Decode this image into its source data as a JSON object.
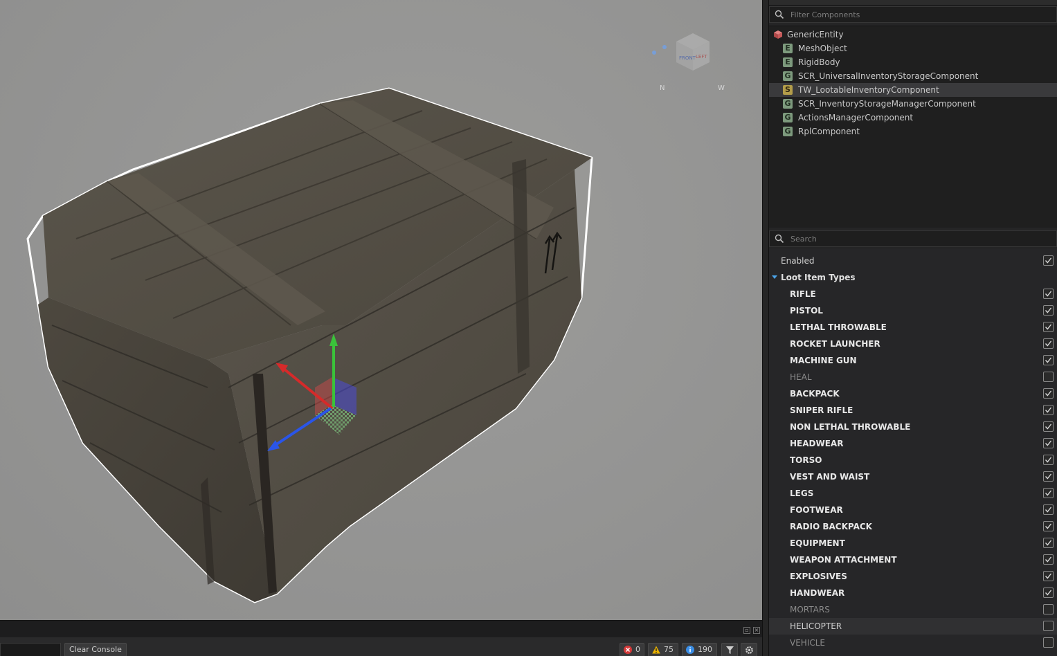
{
  "viewport": {
    "gizmo_axes": [
      "x-axis",
      "y-axis",
      "z-axis"
    ],
    "nav_cube": {
      "labels": [
        "FRONT",
        "LEFT",
        "N",
        "W",
        "E"
      ]
    }
  },
  "hierarchy": {
    "filter_placeholder": "Filter Components",
    "root": {
      "label": "GenericEntity",
      "icon": "entity-cube-icon"
    },
    "components": [
      {
        "badge": "E",
        "label": "MeshObject"
      },
      {
        "badge": "E",
        "label": "RigidBody"
      },
      {
        "badge": "G",
        "label": "SCR_UniversalInventoryStorageComponent"
      },
      {
        "badge": "S",
        "label": "TW_LootableInventoryComponent",
        "selected": true
      },
      {
        "badge": "G",
        "label": "SCR_InventoryStorageManagerComponent"
      },
      {
        "badge": "G",
        "label": "ActionsManagerComponent"
      },
      {
        "badge": "G",
        "label": "RplComponent"
      }
    ]
  },
  "properties": {
    "search_placeholder": "Search",
    "enabled": {
      "label": "Enabled",
      "checked": true
    },
    "section_label": "Loot Item Types",
    "items": [
      {
        "label": "RIFLE",
        "checked": true
      },
      {
        "label": "PISTOL",
        "checked": true
      },
      {
        "label": "LETHAL THROWABLE",
        "checked": true
      },
      {
        "label": "ROCKET LAUNCHER",
        "checked": true
      },
      {
        "label": "MACHINE GUN",
        "checked": true
      },
      {
        "label": "HEAL",
        "checked": false
      },
      {
        "label": "BACKPACK",
        "checked": true
      },
      {
        "label": "SNIPER RIFLE",
        "checked": true
      },
      {
        "label": "NON LETHAL THROWABLE",
        "checked": true
      },
      {
        "label": "HEADWEAR",
        "checked": true
      },
      {
        "label": "TORSO",
        "checked": true
      },
      {
        "label": "VEST AND WAIST",
        "checked": true
      },
      {
        "label": "LEGS",
        "checked": true
      },
      {
        "label": "FOOTWEAR",
        "checked": true
      },
      {
        "label": "RADIO BACKPACK",
        "checked": true
      },
      {
        "label": "EQUIPMENT",
        "checked": true
      },
      {
        "label": "WEAPON ATTACHMENT",
        "checked": true
      },
      {
        "label": "EXPLOSIVES",
        "checked": true
      },
      {
        "label": "HANDWEAR",
        "checked": true
      },
      {
        "label": "MORTARS",
        "checked": false
      },
      {
        "label": "HELICOPTER",
        "checked": false,
        "hover": true
      },
      {
        "label": "VEHICLE",
        "checked": false
      }
    ]
  },
  "console": {
    "clear_label": "Clear Console",
    "errors": "0",
    "warnings": "75",
    "infos": "190"
  },
  "colors": {
    "accent": "#4aa3e8",
    "error": "#d63a3a",
    "warning": "#e8b100",
    "info": "#3a8ee6",
    "badge_generic": "#7d9a7d",
    "badge_script": "#b39d4a"
  }
}
